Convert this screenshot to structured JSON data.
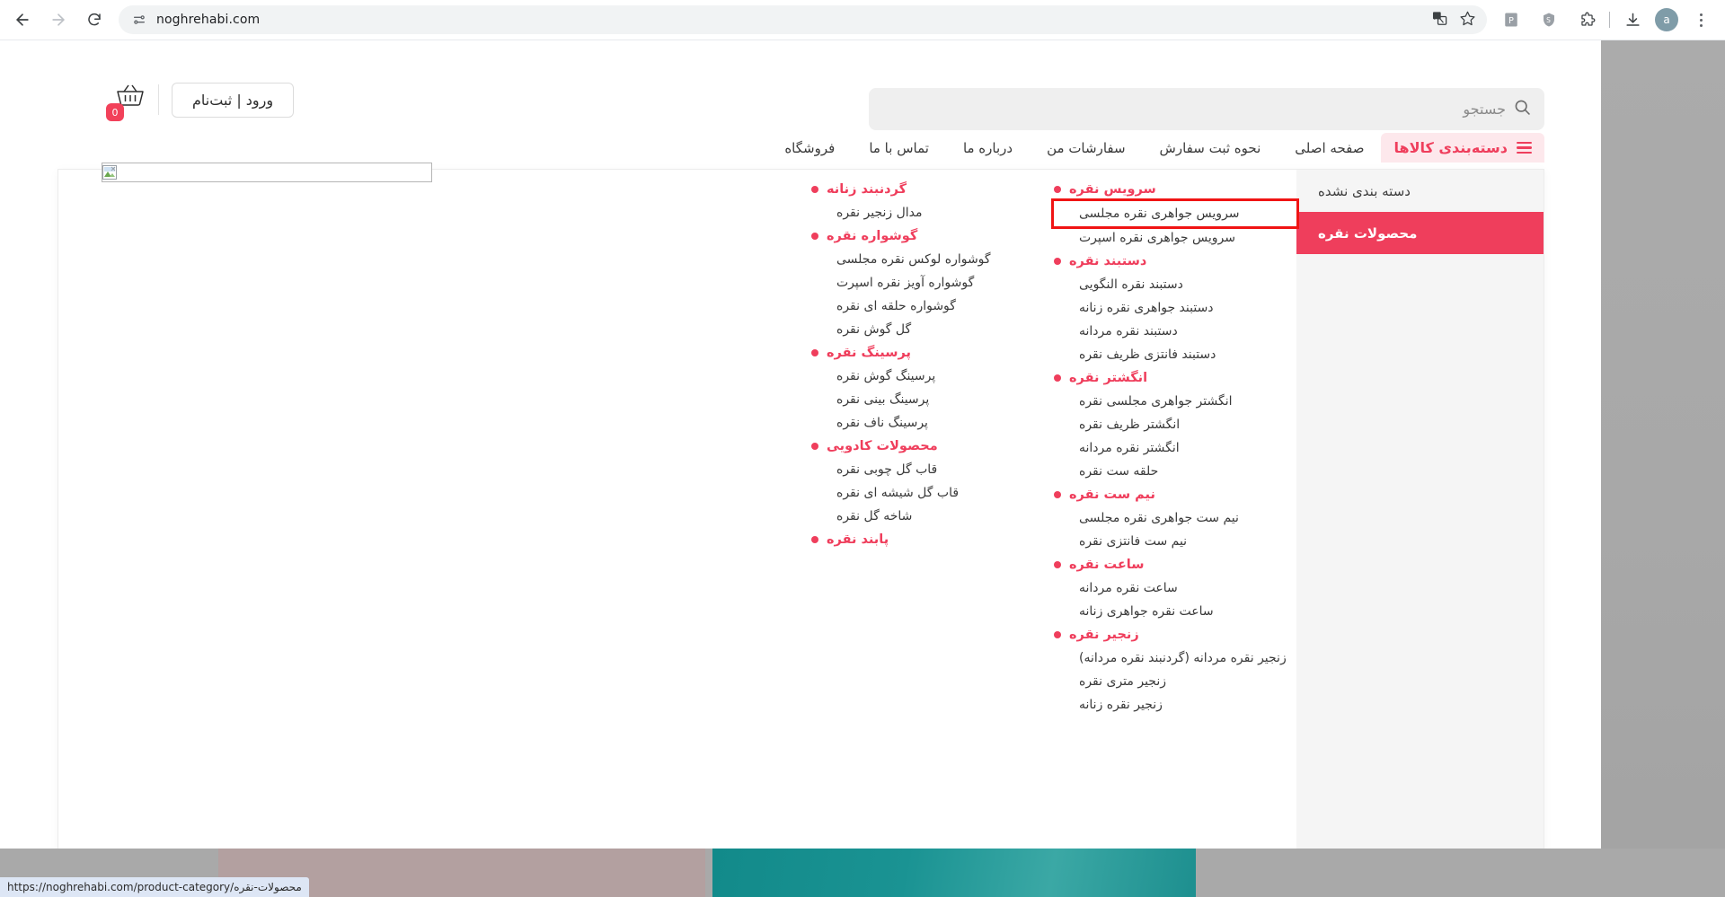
{
  "browser": {
    "url": "noghrehabi.com",
    "back_label": "back-navigation",
    "forward_label": "forward-navigation",
    "reload_label": "reload",
    "profile_initial": "a",
    "icons": {
      "site_settings": "tune-icon",
      "translate": "translate-icon",
      "bookmark": "star-icon",
      "extension_1": "extension-puzzle-icon",
      "shield": "shield-icon",
      "downloads": "download-icon",
      "menu": "kebab-menu-icon"
    }
  },
  "site": {
    "header": {
      "login_register": "ورود | ثبت‌نام",
      "cart_count": "0",
      "search_placeholder": "جستجو",
      "search_value": ""
    },
    "nav": {
      "categories_label": "دسته‌بندی کالاها",
      "links": [
        {
          "label": "صفحه اصلی"
        },
        {
          "label": "نحوه ثبت سفارش"
        },
        {
          "label": "سفارشات من"
        },
        {
          "label": "درباره ما"
        },
        {
          "label": "تماس با ما"
        },
        {
          "label": "فروشگاه"
        }
      ]
    },
    "mega_menu": {
      "sidebar": [
        {
          "label": "دسته بندی نشده",
          "active": false
        },
        {
          "label": "محصولات نقره",
          "active": true
        }
      ],
      "column_right": [
        {
          "type": "head",
          "label": "سرویس نقره"
        },
        {
          "type": "sub",
          "label": "سرویس جواهری نقره مجلسی",
          "highlighted": true
        },
        {
          "type": "sub",
          "label": "سرویس جواهری نقره اسپرت"
        },
        {
          "type": "head",
          "label": "دستبند نقره"
        },
        {
          "type": "sub",
          "label": "دستبند نقره النگویی"
        },
        {
          "type": "sub",
          "label": "دستبند جواهری نقره زنانه"
        },
        {
          "type": "sub",
          "label": "دستبند نقره مردانه"
        },
        {
          "type": "sub",
          "label": "دستبند فانتزی ظریف نقره"
        },
        {
          "type": "head",
          "label": "انگشتر نقره"
        },
        {
          "type": "sub",
          "label": "انگشتر جواهری مجلسی نقره"
        },
        {
          "type": "sub",
          "label": "انگشتر ظریف نقره"
        },
        {
          "type": "sub",
          "label": "انگشتر نقره مردانه"
        },
        {
          "type": "sub",
          "label": "حلقه ست نقره"
        },
        {
          "type": "head",
          "label": "نیم ست نقره"
        },
        {
          "type": "sub",
          "label": "نیم ست جواهری نقره مجلسی"
        },
        {
          "type": "sub",
          "label": "نیم ست فانتزی نقره"
        },
        {
          "type": "head",
          "label": "ساعت نقره"
        },
        {
          "type": "sub",
          "label": "ساعت نقره مردانه"
        },
        {
          "type": "sub",
          "label": "ساعت نقره جواهری زنانه"
        },
        {
          "type": "head",
          "label": "زنجیر نقره"
        },
        {
          "type": "sub",
          "label": "زنجیر نقره مردانه (گردنبند نقره مردانه)"
        },
        {
          "type": "sub",
          "label": "زنجیر متری نقره"
        },
        {
          "type": "sub",
          "label": "زنجیر نقره زنانه"
        }
      ],
      "column_left": [
        {
          "type": "head",
          "label": "گردنبند زنانه"
        },
        {
          "type": "sub",
          "label": "مدال زنجیر نقره"
        },
        {
          "type": "head",
          "label": "گوشواره نقره"
        },
        {
          "type": "sub",
          "label": "گوشواره لوکس نقره مجلسی"
        },
        {
          "type": "sub",
          "label": "گوشواره آویز نقره اسپرت"
        },
        {
          "type": "sub",
          "label": "گوشواره حلقه ای نقره"
        },
        {
          "type": "sub",
          "label": "گل گوش نقره"
        },
        {
          "type": "head",
          "label": "پرسینگ نقره"
        },
        {
          "type": "sub",
          "label": "پرسینگ گوش نقره"
        },
        {
          "type": "sub",
          "label": "پرسینگ بینی نقره"
        },
        {
          "type": "sub",
          "label": "پرسینگ ناف نقره"
        },
        {
          "type": "head",
          "label": "محصولات کادویی"
        },
        {
          "type": "sub",
          "label": "قاب گل چوبی نقره"
        },
        {
          "type": "sub",
          "label": "قاب گل شیشه ای نقره"
        },
        {
          "type": "sub",
          "label": "شاخه گل نقره"
        },
        {
          "type": "head",
          "label": "پابند نقره"
        }
      ]
    },
    "broken_image_alt": ""
  },
  "status_bar": {
    "url": "https://noghrehabi.com/product-category/محصولات-نقره"
  },
  "colors": {
    "accent_pink": "#ef3e5c",
    "accent_pink_soft": "#fde8ec",
    "highlight_box": "#f01414",
    "search_bg": "#efefef",
    "banner_mauve": "#b3a0a0",
    "banner_teal": "#168f8f"
  }
}
